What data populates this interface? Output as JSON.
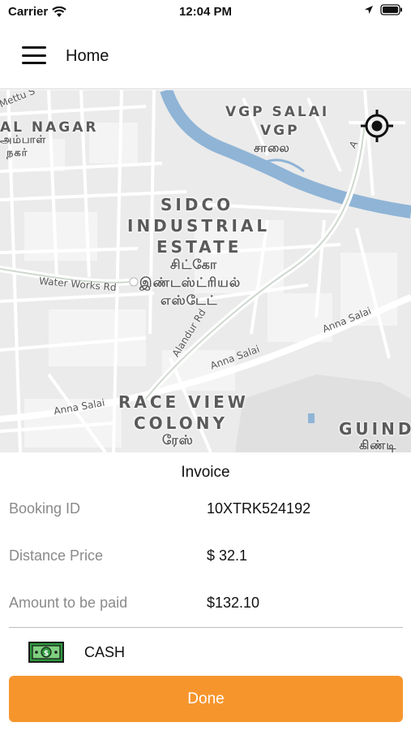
{
  "status_bar": {
    "carrier": "Carrier",
    "time": "12:04 PM",
    "icons": [
      "wifi-icon",
      "location-arrow-icon",
      "battery-icon"
    ]
  },
  "nav": {
    "title": "Home",
    "menu_icon": "hamburger-menu-icon"
  },
  "map": {
    "labels": {
      "nagar": "AL NAGAR",
      "nagar_tamil_1": "அம்பாள்",
      "nagar_tamil_2": "நகர்",
      "vgp_1": "VGP SALAI",
      "vgp_2": "VGP",
      "vgp_tamil": "சாலை",
      "sidco_1": "SIDCO",
      "sidco_2": "INDUSTRIAL",
      "sidco_3": "ESTATE",
      "sidco_tamil_1": "சிட்கோ",
      "sidco_tamil_2": "இண்டஸ்ட்ரியல்",
      "sidco_tamil_3": "எஸ்டேட்",
      "race_1": "RACE VIEW",
      "race_2": "COLONY",
      "race_tamil": "ரேஸ்",
      "guindy": "GUIND",
      "guindy_tamil": "கிண்டி",
      "mettu": "Mettu S"
    },
    "roads": {
      "water_works": "Water Works Rd",
      "alandur": "Alandur Rd",
      "anna_salai_1": "Anna Salai",
      "anna_salai_2": "Anna Salai",
      "anna_salai_3": "Anna Salai",
      "a_marker": "A"
    },
    "locate_icon": "locate-crosshair-icon"
  },
  "invoice": {
    "title": "Invoice",
    "rows": [
      {
        "label": "Booking ID",
        "value": "10XTRK524192"
      },
      {
        "label": "Distance Price",
        "value": "$ 32.1"
      },
      {
        "label": "Amount to be paid",
        "value": "$132.10"
      }
    ],
    "payment": {
      "icon": "cash-icon",
      "label": "CASH"
    },
    "done_label": "Done"
  },
  "colors": {
    "accent": "#f7952d",
    "map_background": "#ebebeb",
    "water": "#8fb4d6"
  }
}
